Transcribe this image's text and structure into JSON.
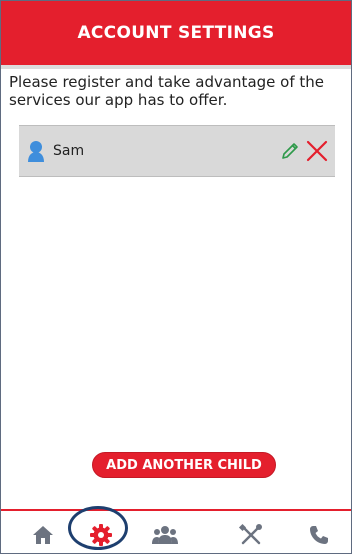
{
  "header": {
    "title": "ACCOUNT SETTINGS"
  },
  "intro": {
    "text": "Please register and take advantage of the services our app has to offer."
  },
  "children": [
    {
      "name": "Sam"
    }
  ],
  "actions": {
    "add_child_label": "ADD ANOTHER CHILD"
  },
  "nav": {
    "items": [
      {
        "icon": "home-icon"
      },
      {
        "icon": "gear-icon",
        "active": true
      },
      {
        "icon": "group-icon"
      },
      {
        "icon": "tools-icon"
      },
      {
        "icon": "phone-icon"
      }
    ]
  },
  "colors": {
    "brand": "#e41f2d",
    "row_bg": "#d9d9d9",
    "icon_gray": "#6c7380",
    "edit_green": "#2e9a4a",
    "avatar_blue": "#3f8edc",
    "highlight_ring": "#1e3f6f"
  }
}
